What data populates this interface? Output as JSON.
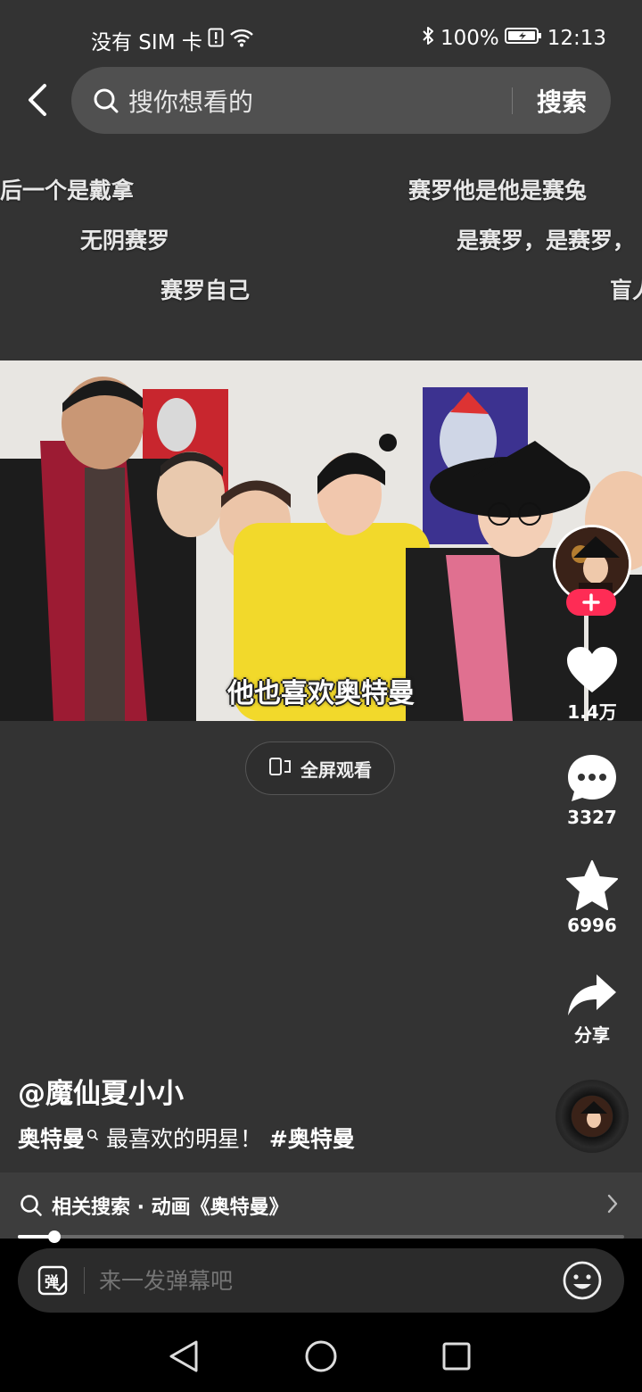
{
  "status_bar": {
    "carrier": "没有 SIM 卡",
    "battery": "100%",
    "time": "12:13"
  },
  "search": {
    "placeholder": "搜你想看的",
    "button": "搜索"
  },
  "danmaku": [
    "后一个是戴拿",
    "赛罗他是他是赛兔",
    "无阴赛罗",
    "是赛罗，是赛罗，",
    "赛罗自己",
    "盲人"
  ],
  "video": {
    "subtitle": "他也喜欢奥特曼"
  },
  "fullscreen_label": "全屏观看",
  "actions": {
    "likes": "1.4万",
    "comments": "3327",
    "favorites": "6996",
    "share": "分享"
  },
  "author": {
    "handle": "@魔仙夏小小"
  },
  "description": {
    "keyword": "奥特曼",
    "text": " 最喜欢的明星！ ",
    "hashtag": "#奥特曼"
  },
  "related_search": {
    "label": "相关搜索 · 动画《奥特曼》"
  },
  "progress": 0.06,
  "comment_bar": {
    "placeholder": "来一发弹幕吧",
    "danmu_glyph": "弹"
  },
  "colors": {
    "background": "#333333",
    "accent": "#fe2c55"
  }
}
